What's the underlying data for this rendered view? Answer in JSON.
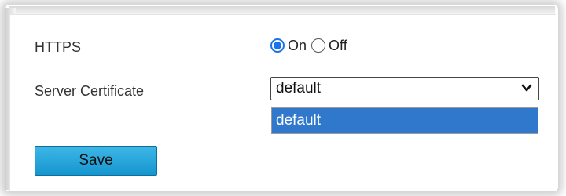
{
  "https": {
    "label": "HTTPS",
    "options": [
      {
        "label": "On",
        "checked": true
      },
      {
        "label": "Off",
        "checked": false
      }
    ]
  },
  "server_certificate": {
    "label": "Server Certificate",
    "selected_value": "default",
    "dropdown_options": [
      "default"
    ]
  },
  "actions": {
    "save_label": "Save"
  },
  "colors": {
    "accent": "#1a73e8",
    "dropdown_highlight": "#2f78cc",
    "save_button": "#1596cf"
  },
  "icons": {
    "select_chevron": "chevron-down-icon"
  }
}
